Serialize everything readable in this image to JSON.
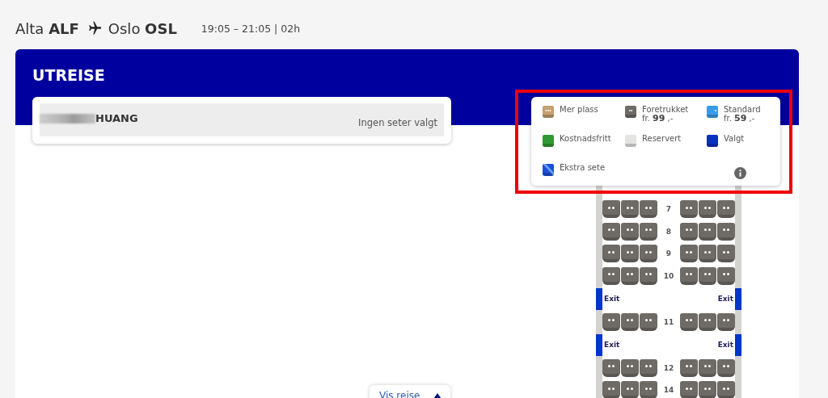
{
  "header": {
    "origin": "Alta **ALF**",
    "destination": "Oslo **OSL**",
    "time": "19:05 – 21:05 | 02h"
  },
  "section_title": "UTREISE",
  "passenger": {
    "name": "HUANG",
    "status": "Ingen seter valgt"
  },
  "legend": [
    {
      "kind": "mer_plass",
      "label": "Mer plass"
    },
    {
      "kind": "foretrukket",
      "label": "Foretrukket",
      "price": "fr. **99** ,-"
    },
    {
      "kind": "standard",
      "label": "Standard",
      "price": "fr. **59** ,-"
    },
    {
      "kind": "kostnadsfritt",
      "label": "Kostnadsfritt"
    },
    {
      "kind": "reservert",
      "label": "Reservert"
    },
    {
      "kind": "valgt",
      "label": "Valgt"
    },
    {
      "kind": "ekstra",
      "label": "Ekstra sete"
    }
  ],
  "seat_rows": [
    {
      "kind": "seats",
      "number": "7",
      "seats": [
        {
          "kind": "foretrukket"
        },
        {
          "kind": "foretrukket"
        },
        {
          "kind": "foretrukket"
        },
        {
          "kind": "foretrukket"
        },
        {
          "kind": "foretrukket"
        },
        {
          "kind": "foretrukket"
        }
      ]
    },
    {
      "kind": "seats",
      "number": "8",
      "seats": [
        {
          "kind": "foretrukket"
        },
        {
          "kind": "foretrukket"
        },
        {
          "kind": "foretrukket"
        },
        {
          "kind": "foretrukket"
        },
        {
          "kind": "foretrukket"
        },
        {
          "kind": "foretrukket"
        }
      ]
    },
    {
      "kind": "seats",
      "number": "9",
      "seats": [
        {
          "kind": "foretrukket"
        },
        {
          "kind": "foretrukket"
        },
        {
          "kind": "foretrukket"
        },
        {
          "kind": "foretrukket"
        },
        {
          "kind": "foretrukket"
        },
        {
          "kind": "foretrukket"
        }
      ]
    },
    {
      "kind": "seats",
      "number": "10",
      "seats": [
        {
          "kind": "foretrukket"
        },
        {
          "kind": "foretrukket"
        },
        {
          "kind": "foretrukket"
        },
        {
          "kind": "foretrukket"
        },
        {
          "kind": "foretrukket"
        },
        {
          "kind": "foretrukket"
        }
      ]
    },
    {
      "kind": "exit",
      "left": "Exit",
      "right": "Exit"
    },
    {
      "kind": "seats",
      "number": "11",
      "seats": [
        {
          "kind": "foretrukket"
        },
        {
          "kind": "foretrukket"
        },
        {
          "kind": "foretrukket"
        },
        {
          "kind": "foretrukket"
        },
        {
          "kind": "foretrukket"
        },
        {
          "kind": "foretrukket"
        }
      ]
    },
    {
      "kind": "exit",
      "left": "Exit",
      "right": "Exit"
    },
    {
      "kind": "seats",
      "number": "12",
      "seats": [
        {
          "kind": "foretrukket"
        },
        {
          "kind": "foretrukket"
        },
        {
          "kind": "foretrukket"
        },
        {
          "kind": "foretrukket"
        },
        {
          "kind": "foretrukket"
        },
        {
          "kind": "foretrukket"
        }
      ]
    },
    {
      "kind": "seats",
      "number": "14",
      "seats": [
        {
          "kind": "foretrukket"
        },
        {
          "kind": "foretrukket"
        },
        {
          "kind": "foretrukket"
        },
        {
          "kind": "foretrukket"
        },
        {
          "kind": "foretrukket"
        },
        {
          "kind": "foretrukket"
        }
      ]
    }
  ],
  "trip_button": {
    "label": "Vis reise"
  }
}
